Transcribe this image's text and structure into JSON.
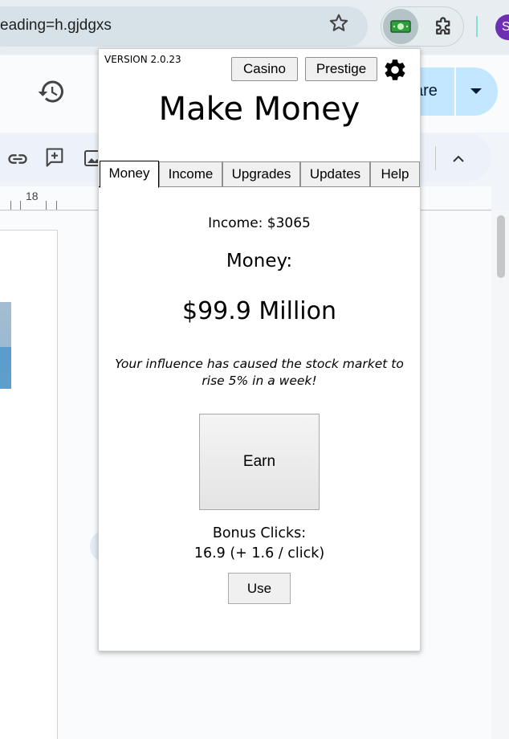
{
  "browser": {
    "url_fragment": "eading=h.gjdgxs",
    "profile_initial": "S",
    "extension_icon": "money-bill-icon"
  },
  "docs": {
    "share_label": "are",
    "ruler_number": "18"
  },
  "popup": {
    "version": "VERSION 2.0.23",
    "casino_label": "Casino",
    "prestige_label": "Prestige",
    "title": "Make Money",
    "tabs": [
      {
        "label": "Money",
        "active": true
      },
      {
        "label": "Income",
        "active": false
      },
      {
        "label": "Upgrades",
        "active": false
      },
      {
        "label": "Updates",
        "active": false
      },
      {
        "label": "Help",
        "active": false
      }
    ],
    "income_text": "Income: $3065",
    "money_label": "Money:",
    "money_value": "$99.9 Million",
    "news": "Your influence has caused the stock market to rise 5% in a week!",
    "earn_label": "Earn",
    "bonus_label": "Bonus Clicks:",
    "bonus_value": "16.9 (+ 1.6 / click)",
    "use_label": "Use"
  },
  "colors": {
    "share_button": "#c2e7ff",
    "avatar": "#6f2fb4",
    "extension_bill": "#2e9e3e"
  }
}
